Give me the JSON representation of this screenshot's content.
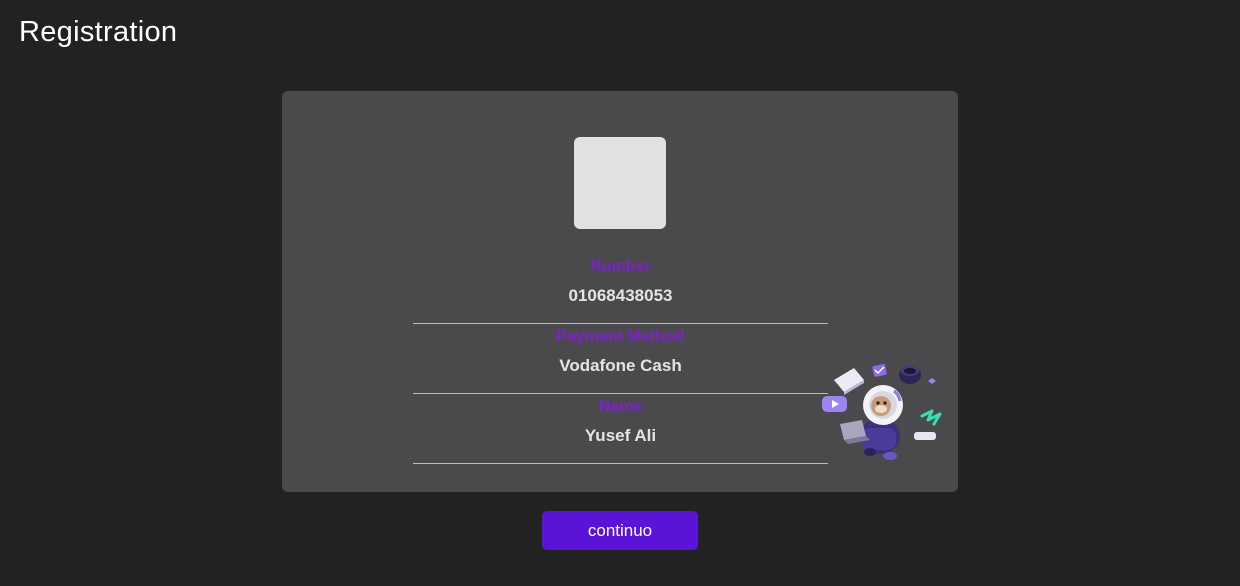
{
  "header": {
    "title": "Registration"
  },
  "card": {
    "photo_icon": "image-placeholder-icon",
    "fields": [
      {
        "label": "Number",
        "value": "01068438053"
      },
      {
        "label": "Payment Method",
        "value": "Vodafone Cash"
      },
      {
        "label": "Name",
        "value": "Yusef Ali"
      }
    ],
    "illustration_icon": "astronaut-illustration-icon"
  },
  "actions": {
    "continue_label": "continuo"
  },
  "colors": {
    "page_background": "#222222",
    "card_background": "#4a4a4c",
    "label": "#7b22c9",
    "value": "#e4e4e4",
    "button": "#5a13d7",
    "button_text": "#ffffff"
  }
}
